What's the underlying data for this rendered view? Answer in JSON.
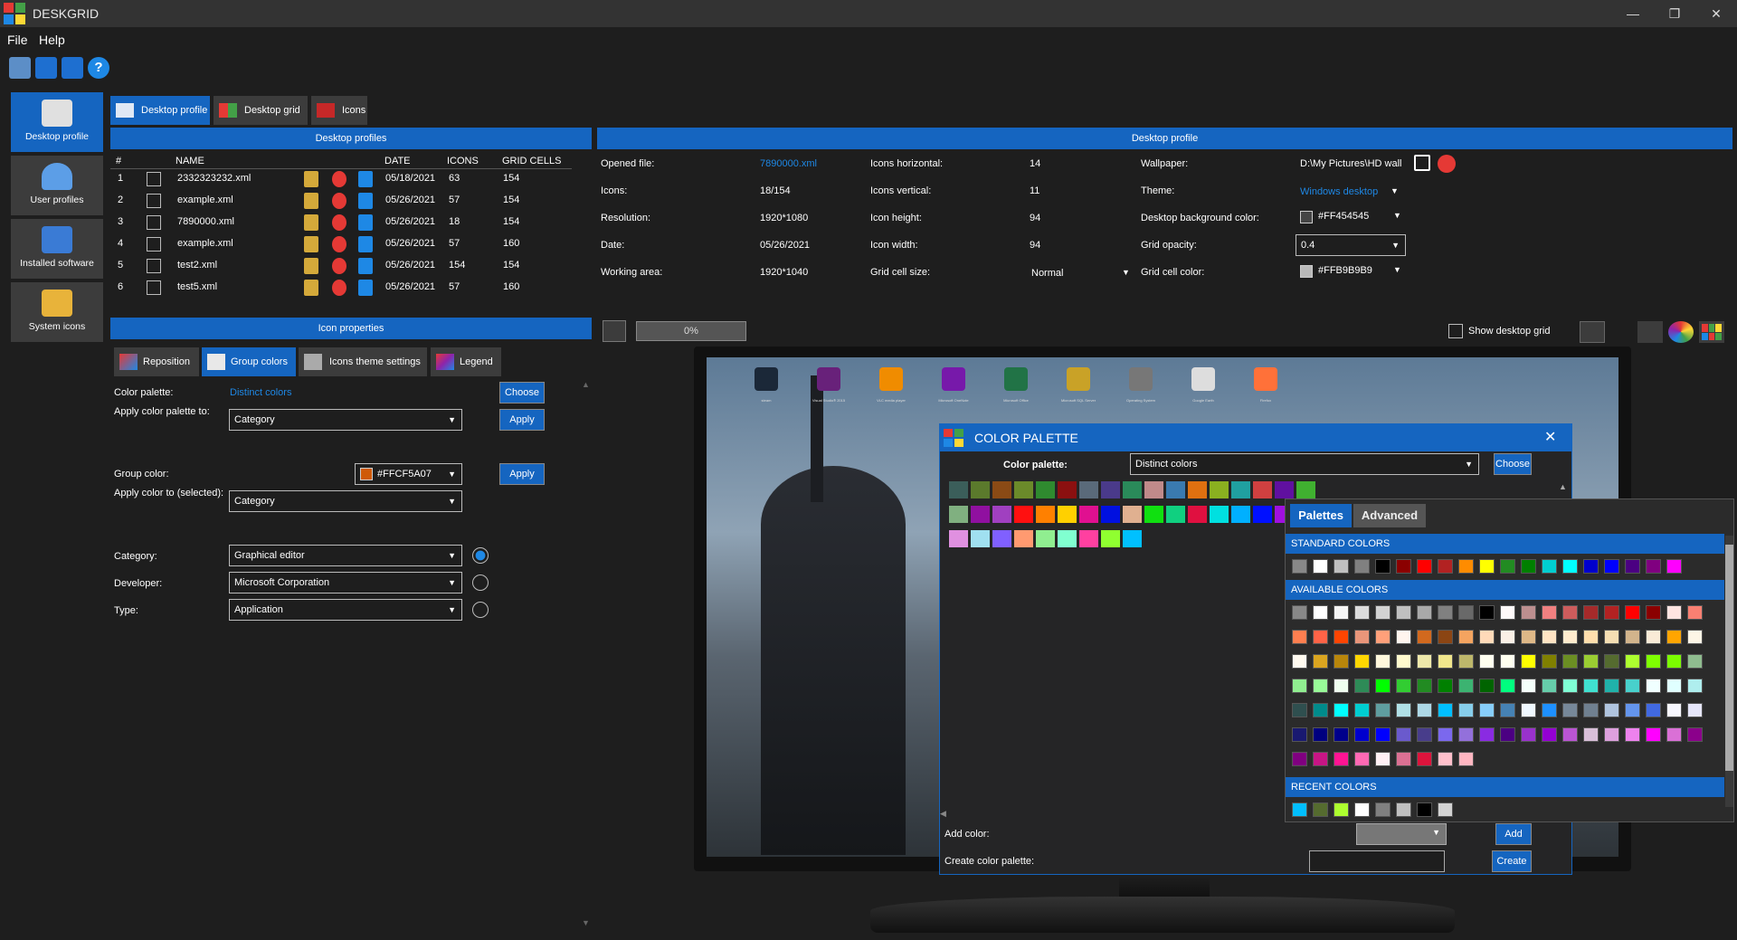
{
  "app": {
    "title": "DESKGRID"
  },
  "menu": [
    "File",
    "Help"
  ],
  "sidebar": [
    {
      "label": "Desktop profile",
      "active": true
    },
    {
      "label": "User profiles"
    },
    {
      "label": "Installed software"
    },
    {
      "label": "System icons"
    }
  ],
  "tabs": [
    {
      "label": "Desktop profile",
      "active": true
    },
    {
      "label": "Desktop grid"
    },
    {
      "label": "Icons"
    }
  ],
  "profiles": {
    "header": "Desktop profiles",
    "columns": [
      "#",
      "NAME",
      "DATE",
      "ICONS",
      "GRID CELLS"
    ],
    "rows": [
      {
        "n": "1",
        "name": "2332323232.xml",
        "date": "05/18/2021",
        "icons": "63",
        "cells": "154"
      },
      {
        "n": "2",
        "name": "example.xml",
        "date": "05/26/2021",
        "icons": "57",
        "cells": "154"
      },
      {
        "n": "3",
        "name": "7890000.xml",
        "date": "05/26/2021",
        "icons": "18",
        "cells": "154"
      },
      {
        "n": "4",
        "name": "example.xml",
        "date": "05/26/2021",
        "icons": "57",
        "cells": "160"
      },
      {
        "n": "5",
        "name": "test2.xml",
        "date": "05/26/2021",
        "icons": "154",
        "cells": "154"
      },
      {
        "n": "6",
        "name": "test5.xml",
        "date": "05/26/2021",
        "icons": "57",
        "cells": "160"
      }
    ]
  },
  "iconprops": {
    "header": "Icon properties",
    "subtabs": [
      "Reposition",
      "Group colors",
      "Icons theme settings",
      "Legend"
    ],
    "color_palette_label": "Color palette:",
    "color_palette_value": "Distinct colors",
    "choose": "Choose",
    "apply_palette_label": "Apply color palette to:",
    "apply_palette_value": "Category",
    "apply": "Apply",
    "group_color_label": "Group color:",
    "group_color_value": "#FFCF5A07",
    "group_color_hex": "#CF5A07",
    "apply_color_label": "Apply color to (selected):",
    "apply_color_value": "Category",
    "category_label": "Category:",
    "category_value": "Graphical editor",
    "developer_label": "Developer:",
    "developer_value": "Microsoft Corporation",
    "type_label": "Type:",
    "type_value": "Application"
  },
  "profile": {
    "header": "Desktop profile",
    "opened_file_label": "Opened file:",
    "opened_file": "7890000.xml",
    "icons_label": "Icons:",
    "icons": "18/154",
    "resolution_label": "Resolution:",
    "resolution": "1920*1080",
    "date_label": "Date:",
    "date": "05/26/2021",
    "working_label": "Working area:",
    "working": "1920*1040",
    "ih_label": "Icons horizontal:",
    "ih": "14",
    "iv_label": "Icons vertical:",
    "iv": "11",
    "iheight_label": "Icon height:",
    "iheight": "94",
    "iwidth_label": "Icon width:",
    "iwidth": "94",
    "cell_label": "Grid cell size:",
    "cell": "Normal",
    "wallpaper_label": "Wallpaper:",
    "wallpaper": "D:\\My Pictures\\HD wall",
    "theme_label": "Theme:",
    "theme": "Windows desktop",
    "bg_label": "Desktop background color:",
    "bg": "#FF454545",
    "opacity_label": "Grid opacity:",
    "opacity": "0.4",
    "cellcolor_label": "Grid cell color:",
    "cellcolor": "#FFB9B9B9",
    "progress": "0%",
    "progress_value": 0,
    "show_grid": "Show desktop grid"
  },
  "desktop_icons": [
    "steam",
    "Visual Studio® 2015",
    "VLC media player",
    "Microsoft OneNote",
    "Microsoft Office",
    "Microsoft SQL Server",
    "Operating System",
    "Google Earth",
    "Firefox"
  ],
  "palette_dialog": {
    "title": "COLOR PALETTE",
    "palette_label": "Color palette:",
    "palette_value": "Distinct colors",
    "choose": "Choose",
    "add_color_label": "Add color:",
    "add": "Add",
    "create_label": "Create color palette:",
    "create": "Create",
    "swatches": [
      "#3b5e5a",
      "#5b7a2c",
      "#8a4a15",
      "#6b8a2a",
      "#2f8a2f",
      "#8b1010",
      "#5a6a7a",
      "#4a3a8a",
      "#2a8a5a",
      "#c08a8a",
      "#3a7ab0",
      "#e07010",
      "#8ab020",
      "#20a0a0",
      "#d04040",
      "#6010a0",
      "#40b030",
      "#80b080",
      "#9010a0",
      "#a040c0",
      "#ff1010",
      "#ff8000",
      "#ffd000",
      "#e01090",
      "#0010e0",
      "#e0b090",
      "#10e010",
      "#10d080",
      "#e01040",
      "#00e0e0",
      "#00b0ff",
      "#0010ff",
      "#a010e0",
      "#6a8ae0",
      "#e090e0",
      "#a0e0f0",
      "#8060ff",
      "#ff9a70",
      "#90ee90",
      "#80ffd0",
      "#ff40a0",
      "#90ff30",
      "#00c0ff"
    ]
  },
  "color_picker": {
    "tabs": [
      "Palettes",
      "Advanced"
    ],
    "standard_label": "STANDARD COLORS",
    "available_label": "AVAILABLE COLORS",
    "recent_label": "RECENT COLORS",
    "standard": [
      "#888888",
      "#ffffff",
      "#c0c0c0",
      "#808080",
      "#000000",
      "#8b0000",
      "#ff0000",
      "#b22222",
      "#ff8c00",
      "#ffff00",
      "#228b22",
      "#008000",
      "#00ced1",
      "#00ffff",
      "#0000cd",
      "#0000ff",
      "#4b0082",
      "#800080",
      "#ff00ff"
    ],
    "available": [
      "#888888",
      "#ffffff",
      "#f5f5f5",
      "#dcdcdc",
      "#d3d3d3",
      "#c0c0c0",
      "#a9a9a9",
      "#808080",
      "#696969",
      "#000000",
      "#fffafa",
      "#bc8f8f",
      "#f08080",
      "#cd5c5c",
      "#a52a2a",
      "#b22222",
      "#ff0000",
      "#8b0000",
      "#ffe4e1",
      "#fa8072",
      "#ff7f50",
      "#ff6347",
      "#ff4500",
      "#e9967a",
      "#ffa07a",
      "#fff5ee",
      "#d2691e",
      "#8b4513",
      "#f4a460",
      "#ffdab9",
      "#faf0e6",
      "#deb887",
      "#ffe4c4",
      "#ffebcd",
      "#ffdead",
      "#f5deb3",
      "#d2b48c",
      "#faebd7",
      "#ffa500",
      "#fdf5e6",
      "#fffaf0",
      "#daa520",
      "#b8860b",
      "#ffd700",
      "#fff8dc",
      "#fffacd",
      "#eee8aa",
      "#f0e68c",
      "#bdb76b",
      "#fffff0",
      "#fffff0",
      "#ffff00",
      "#808000",
      "#6b8e23",
      "#9acd32",
      "#556b2f",
      "#adff2f",
      "#7fff00",
      "#7cfc00",
      "#8fbc8f",
      "#90ee90",
      "#98fb98",
      "#f0fff0",
      "#2e8b57",
      "#00ff00",
      "#32cd32",
      "#228b22",
      "#008000",
      "#3cb371",
      "#006400",
      "#00ff7f",
      "#f5fffa",
      "#66cdaa",
      "#7fffd4",
      "#40e0d0",
      "#20b2aa",
      "#48d1cc",
      "#f0ffff",
      "#e0ffff",
      "#afeeee",
      "#2f4f4f",
      "#008b8b",
      "#00ffff",
      "#00ced1",
      "#5f9ea0",
      "#b0e0e6",
      "#add8e6",
      "#00bfff",
      "#87ceeb",
      "#87cefa",
      "#4682b4",
      "#f0f8ff",
      "#1e90ff",
      "#778899",
      "#708090",
      "#b0c4de",
      "#6495ed",
      "#4169e1",
      "#f8f8ff",
      "#e6e6fa",
      "#191970",
      "#000080",
      "#00008b",
      "#0000cd",
      "#0000ff",
      "#6a5acd",
      "#483d8b",
      "#7b68ee",
      "#9370db",
      "#8a2be2",
      "#4b0082",
      "#9932cc",
      "#9400d3",
      "#ba55d3",
      "#d8bfd8",
      "#dda0dd",
      "#ee82ee",
      "#ff00ff",
      "#da70d6",
      "#8b008b",
      "#800080",
      "#c71585",
      "#ff1493",
      "#ff69b4",
      "#fff0f5",
      "#db7093",
      "#dc143c",
      "#ffc0cb",
      "#ffb6c1"
    ],
    "recent": [
      "#00bfff",
      "#556b2f",
      "#adff2f",
      "#ffffff",
      "#808080",
      "#c0c0c0",
      "#000000",
      "#d3d3d3"
    ]
  }
}
